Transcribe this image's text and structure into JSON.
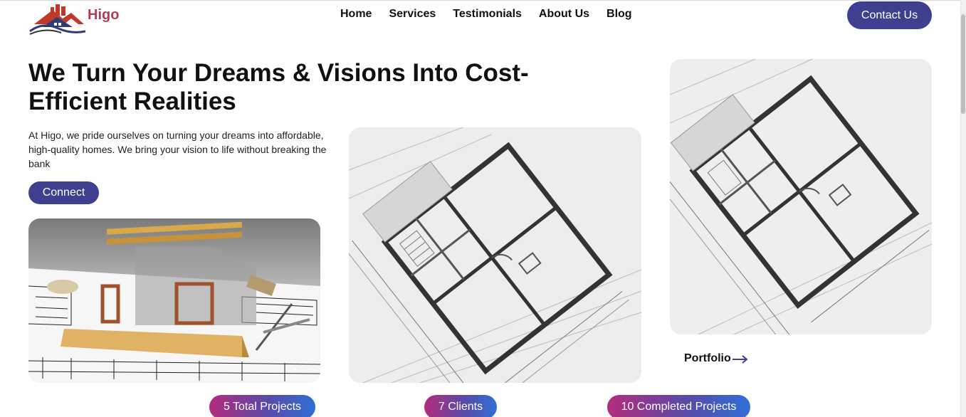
{
  "header": {
    "brand": "Higo",
    "nav": [
      "Home",
      "Services",
      "Testimonials",
      "About Us",
      "Blog"
    ],
    "contact_label": "Contact Us"
  },
  "hero": {
    "headline": "We Turn Your Dreams & Visions Into Cost-Efficient Realities",
    "description": "At Higo, we pride ourselves on turning your dreams into affordable, high-quality homes. We bring your vision to life without breaking the bank",
    "connect_label": "Connect"
  },
  "images": [
    "construction-plan-image",
    "floor-plan-image",
    "floor-plan-image-detail"
  ],
  "portfolio_label": "Portfolio",
  "stats": [
    "5 Total Projects",
    "7 Clients",
    "10 Completed Projects"
  ],
  "colors": {
    "brand": "#b73a54",
    "primary_button": "#3e3f8f",
    "stat_gradient": [
      "#b32c7c",
      "#5a4aa8",
      "#2f6fd6"
    ]
  }
}
